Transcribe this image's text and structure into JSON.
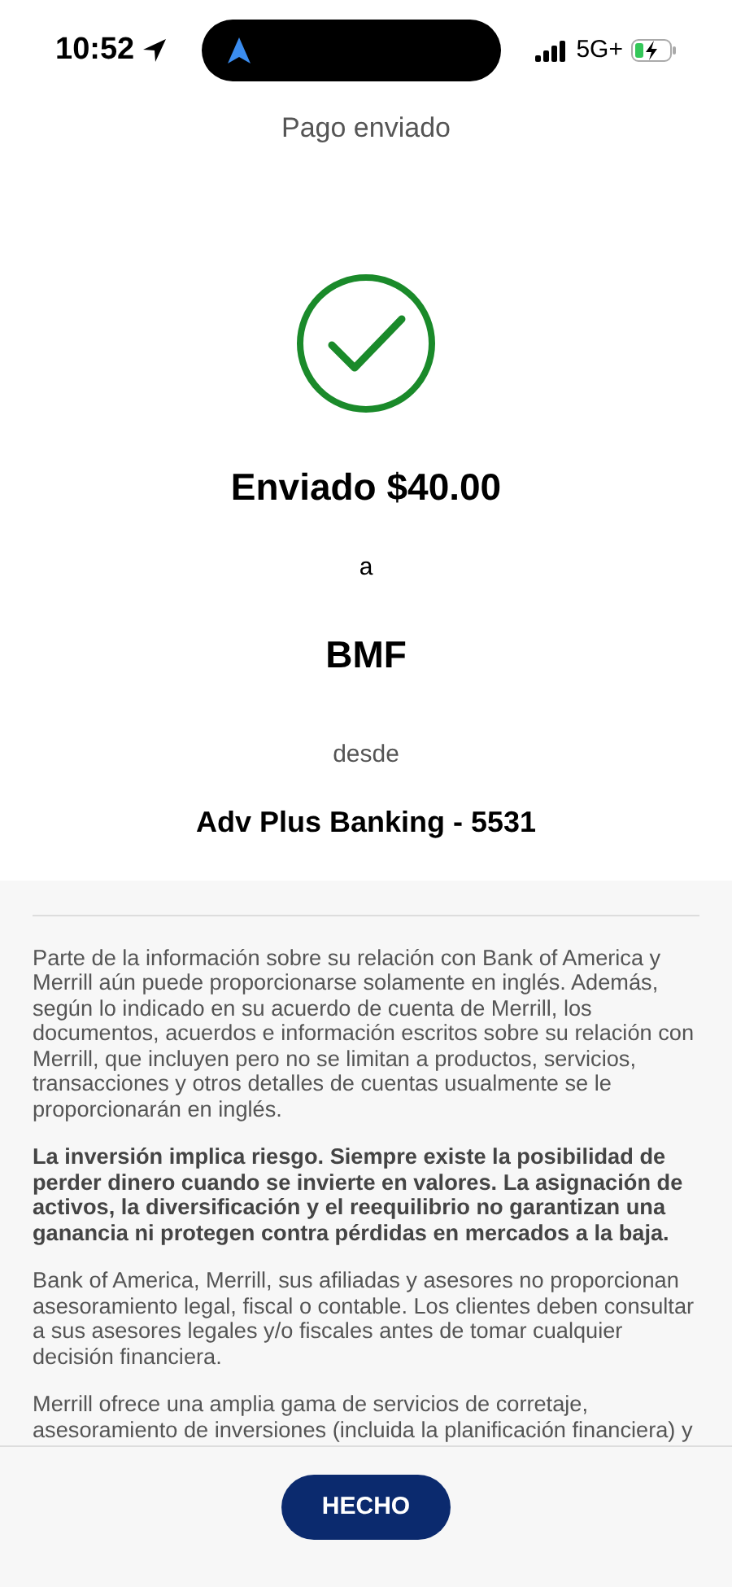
{
  "status_bar": {
    "time": "10:52",
    "network": "5G+"
  },
  "header": {
    "title": "Pago enviado"
  },
  "confirmation": {
    "amount_line": "Enviado $40.00",
    "to_word": "a",
    "recipient": "BMF",
    "from_word": "desde",
    "account": "Adv Plus Banking - 5531"
  },
  "disclosures": [
    {
      "kind": "normal",
      "text": "Parte de la información sobre su relación con Bank of America y Merrill aún puede proporcionarse solamente en inglés. Además, según lo indicado en su acuerdo de cuenta de Merrill, los documentos, acuerdos e información escritos sobre su relación con Merrill, que incluyen pero no se limitan a productos, servicios, transacciones y otros detalles de cuentas usualmente se le proporcionarán en inglés."
    },
    {
      "kind": "bold",
      "text": "La inversión implica riesgo. Siempre existe la posibilidad de perder dinero cuando se invierte en valores. La asignación de activos, la diversificación y el reequilibrio no garantizan una ganancia ni protegen contra pérdidas en mercados a la baja."
    },
    {
      "kind": "normal",
      "text": "Bank of America, Merrill, sus afiliadas y asesores no proporcionan asesoramiento legal, fiscal o contable. Los clientes deben consultar a sus asesores legales y/o fiscales antes de tomar cualquier decisión financiera."
    },
    {
      "kind": "normal",
      "text": "Merrill ofrece una amplia gama de servicios de corretaje, asesoramiento de inversiones (incluida la planificación financiera) y"
    }
  ],
  "done_button": "HECHO"
}
